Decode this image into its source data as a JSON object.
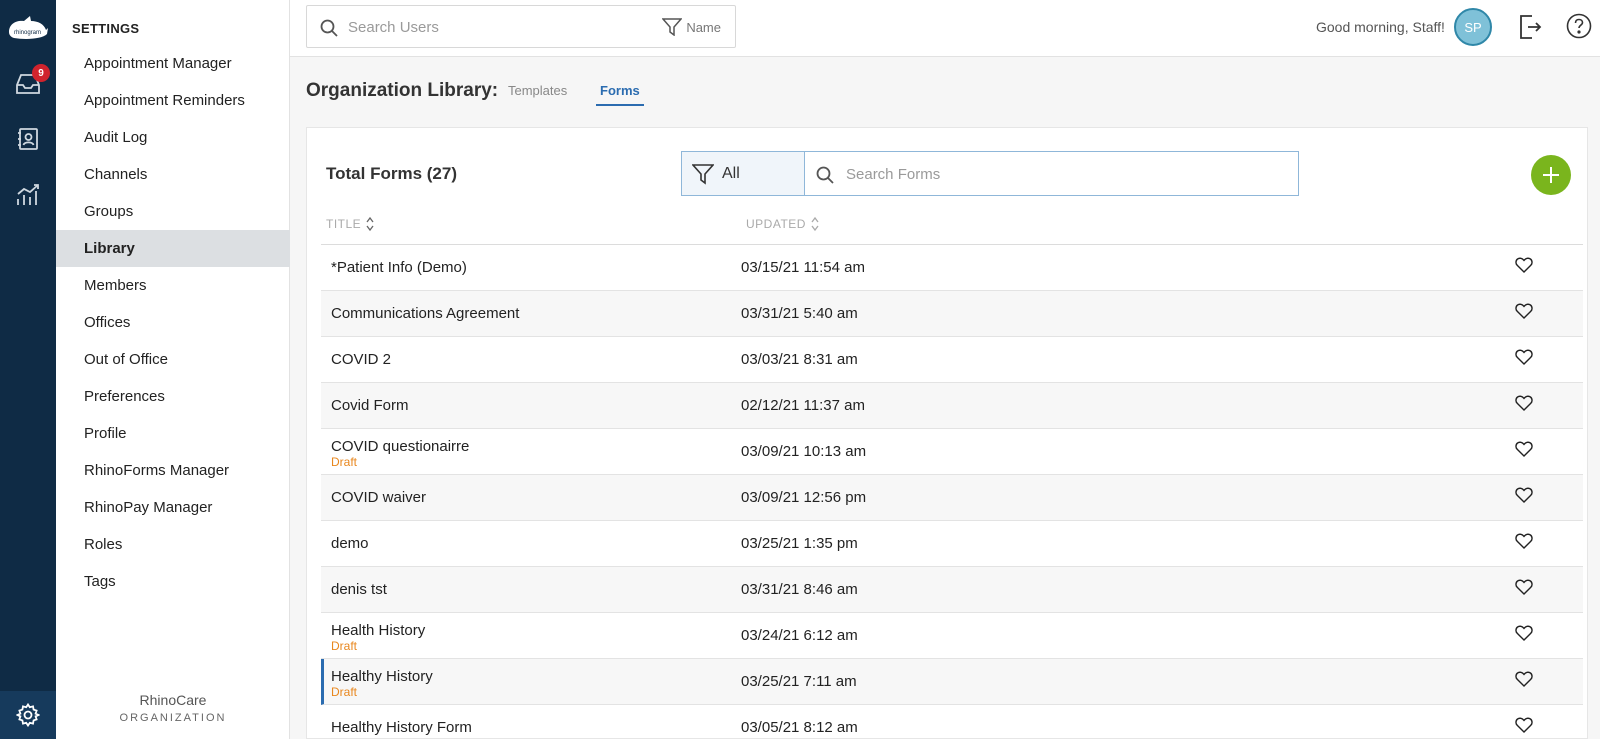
{
  "rail": {
    "inbox_badge": "9",
    "icons": [
      "logo",
      "inbox-icon",
      "contacts-icon",
      "analytics-icon",
      "settings-icon"
    ]
  },
  "sidebar": {
    "heading": "SETTINGS",
    "items": [
      {
        "label": "Appointment Manager"
      },
      {
        "label": "Appointment Reminders"
      },
      {
        "label": "Audit Log"
      },
      {
        "label": "Channels"
      },
      {
        "label": "Groups"
      },
      {
        "label": "Library",
        "active": true
      },
      {
        "label": "Members"
      },
      {
        "label": "Offices"
      },
      {
        "label": "Out of Office"
      },
      {
        "label": "Preferences"
      },
      {
        "label": "Profile"
      },
      {
        "label": "RhinoForms Manager"
      },
      {
        "label": "RhinoPay Manager"
      },
      {
        "label": "Roles"
      },
      {
        "label": "Tags"
      }
    ],
    "org_name": "RhinoCare",
    "org_type": "ORGANIZATION"
  },
  "topbar": {
    "search_placeholder": "Search Users",
    "filter_label": "Name",
    "greeting": "Good morning, Staff!",
    "avatar_initials": "SP"
  },
  "library": {
    "title": "Organization Library:",
    "tabs": [
      {
        "label": "Templates",
        "active": false
      },
      {
        "label": "Forms",
        "active": true
      }
    ]
  },
  "card": {
    "total": "Total Forms (27)",
    "filter_value": "All",
    "search_placeholder": "Search Forms",
    "columns": {
      "title": "TITLE",
      "updated": "UPDATED"
    }
  },
  "forms": [
    {
      "title": "*Patient Info (Demo)",
      "status": "",
      "updated": "03/15/21 11:54 am"
    },
    {
      "title": "Communications Agreement",
      "status": "",
      "updated": "03/31/21 5:40 am"
    },
    {
      "title": "COVID 2",
      "status": "",
      "updated": "03/03/21 8:31 am"
    },
    {
      "title": "Covid Form",
      "status": "",
      "updated": "02/12/21 11:37 am"
    },
    {
      "title": "COVID questionairre",
      "status": "Draft",
      "updated": "03/09/21 10:13 am"
    },
    {
      "title": "COVID waiver",
      "status": "",
      "updated": "03/09/21 12:56 pm"
    },
    {
      "title": "demo",
      "status": "",
      "updated": "03/25/21 1:35 pm"
    },
    {
      "title": "denis tst",
      "status": "",
      "updated": "03/31/21 8:46 am"
    },
    {
      "title": "Health History",
      "status": "Draft",
      "updated": "03/24/21 6:12 am"
    },
    {
      "title": "Healthy History",
      "status": "Draft",
      "updated": "03/25/21 7:11 am",
      "selected": true
    },
    {
      "title": "Healthy History Form",
      "status": "",
      "updated": "03/05/21 8:12 am"
    }
  ],
  "colors": {
    "rail": "#0f2b45",
    "accent": "#2b6cb0",
    "draft": "#e8871e",
    "add": "#7ab51d",
    "badge": "#d0232d"
  }
}
